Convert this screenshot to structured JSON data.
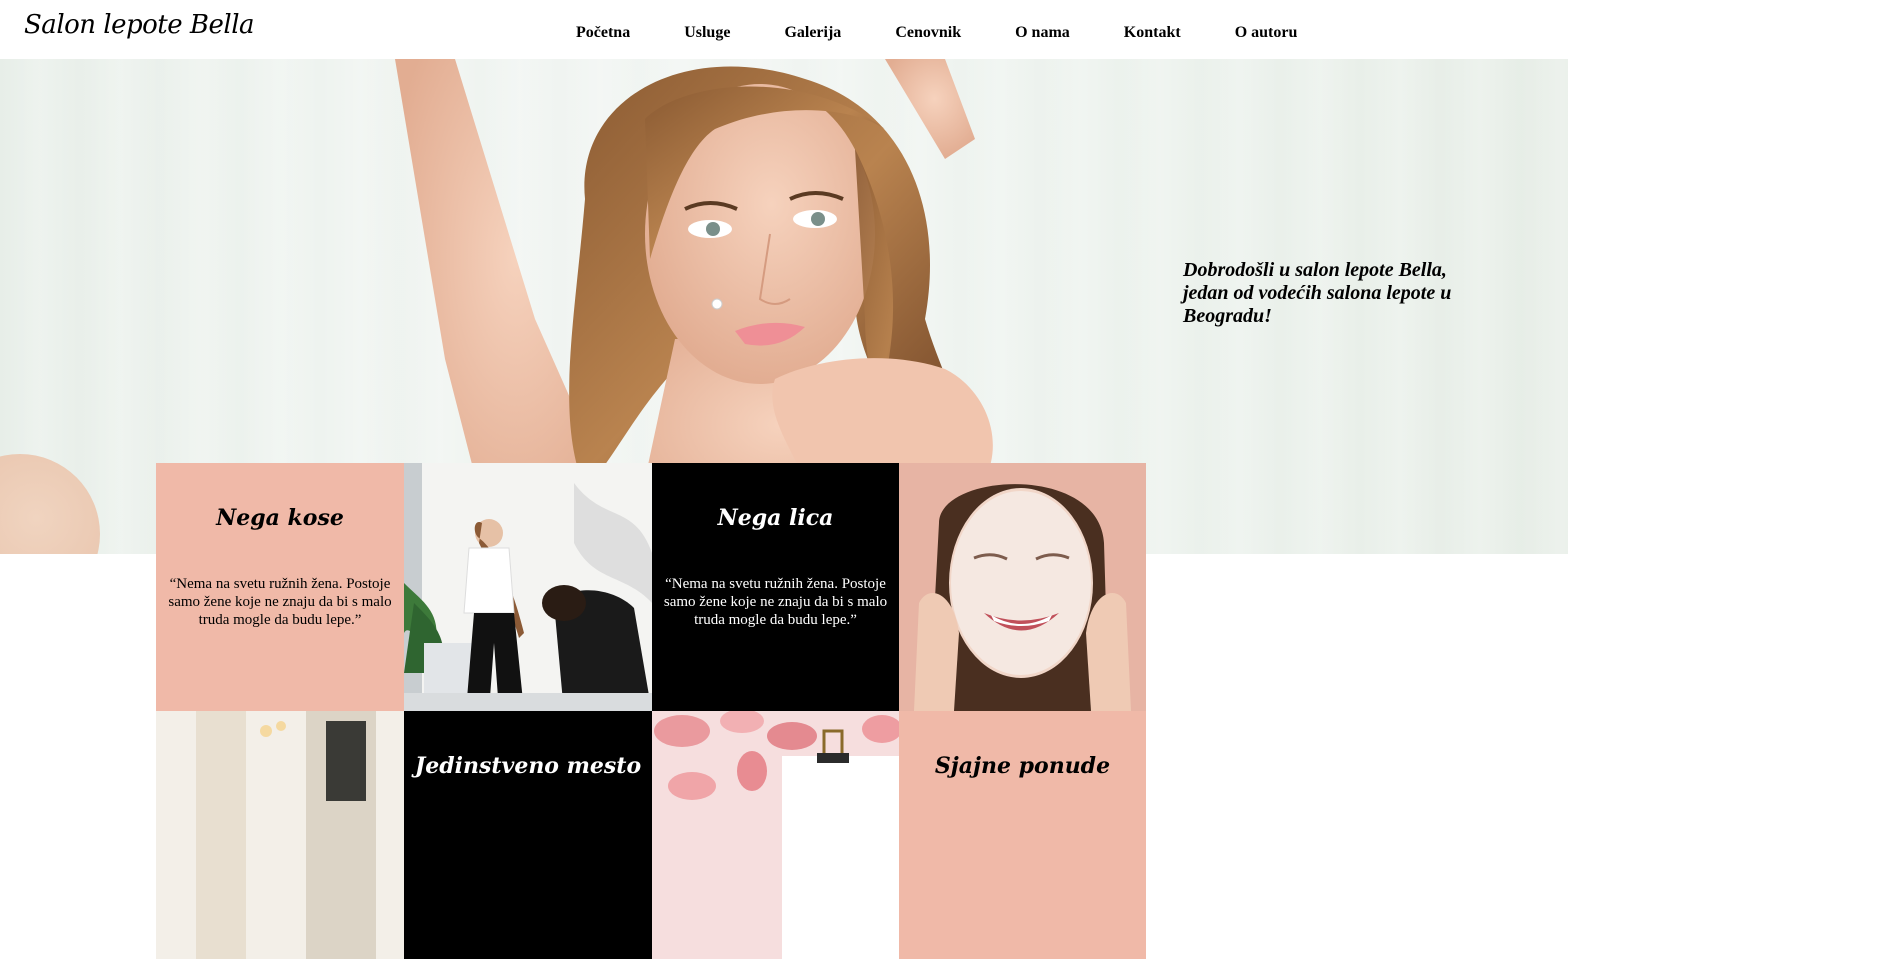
{
  "header": {
    "logo": "Salon lepote Bella",
    "nav": [
      {
        "label": "Početna"
      },
      {
        "label": "Usluge"
      },
      {
        "label": "Galerija"
      },
      {
        "label": "Cenovnik"
      },
      {
        "label": "O nama"
      },
      {
        "label": "Kontakt"
      },
      {
        "label": "O autoru"
      }
    ]
  },
  "hero": {
    "welcome": "Dobrodošli u salon lepote Bella, jedan od vodećih salona lepote u Beogradu!"
  },
  "tiles": [
    {
      "type": "text",
      "title": "Nega kose",
      "quote": "“Nema na svetu ružnih žena. Postoje samo žene koje ne znaju da bi s malo truda mogle da budu lepe.”"
    },
    {
      "type": "photo",
      "subject": "hair-salon-photo"
    },
    {
      "type": "text",
      "title": "Nega lica",
      "quote": "“Nema na svetu ružnih žena. Postoje samo žene koje ne znaju da bi s malo truda mogle da budu lepe.”"
    },
    {
      "type": "photo",
      "subject": "face-mask-photo"
    },
    {
      "type": "photo",
      "subject": "salon-interior-photo"
    },
    {
      "type": "text",
      "title": "Jedinstveno mesto"
    },
    {
      "type": "photo",
      "subject": "rose-petals-photo"
    },
    {
      "type": "text",
      "title": "Sjajne ponude"
    }
  ],
  "colors": {
    "pink_tile": "#f0b9a8",
    "black_tile": "#000000",
    "hero_bg": "#eef3ef"
  }
}
